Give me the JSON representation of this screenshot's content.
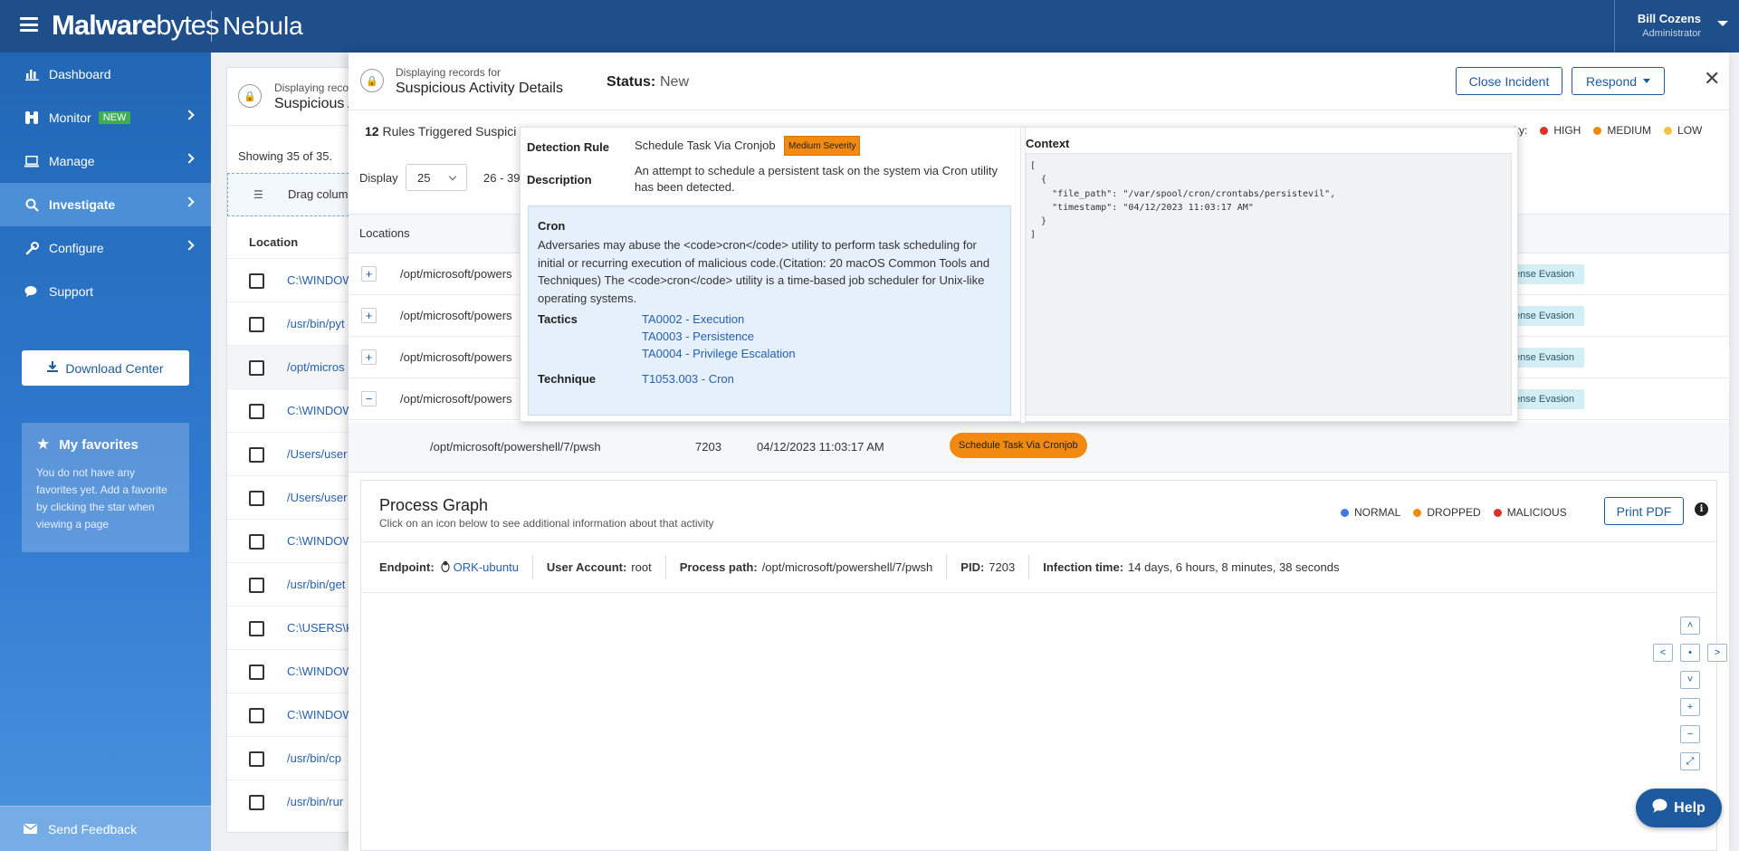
{
  "header": {
    "brand_bold": "Malware",
    "brand_light": "bytes",
    "product": "Nebula",
    "user_name": "Bill Cozens",
    "user_role": "Administrator"
  },
  "sidebar": {
    "items": [
      {
        "label": "Dashboard",
        "icon": "bar-chart-icon"
      },
      {
        "label": "Monitor",
        "badge": "NEW",
        "icon": "binoculars-icon"
      },
      {
        "label": "Manage",
        "icon": "laptop-icon"
      },
      {
        "label": "Investigate",
        "icon": "search-icon",
        "active": true
      },
      {
        "label": "Configure",
        "icon": "wrench-icon"
      },
      {
        "label": "Support",
        "icon": "chat-icon"
      }
    ],
    "download_label": "Download Center",
    "favorites_title": "My favorites",
    "favorites_text": "You do not have any favorites yet. Add a favorite by clicking the star when viewing a page",
    "feedback_label": "Send Feedback"
  },
  "background": {
    "subtitle": "Displaying reco",
    "title": "Suspicious A",
    "showing": "Showing 35 of 35.",
    "drag_text": "Drag colum",
    "column_location": "Location",
    "rows": [
      "C:\\WINDOW",
      "/usr/bin/pyt",
      "/opt/micros",
      "C:\\WINDOW",
      "/Users/user",
      "/Users/user",
      "C:\\WINDOW",
      "/usr/bin/get",
      "C:\\USERS\\K",
      "C:\\WINDOW",
      "C:\\WINDOW",
      "/usr/bin/cp",
      "/usr/bin/rur"
    ]
  },
  "modal": {
    "subtitle": "Displaying records for",
    "title": "Suspicious Activity Details",
    "status_label": "Status:",
    "status_value": "New",
    "close_incident": "Close Incident",
    "respond": "Respond",
    "close_symbol": "✕",
    "rules_count": "12",
    "rules_text": " Rules Triggered Suspici",
    "severity_prefix": "ity:",
    "severity_levels": [
      {
        "label": "HIGH",
        "color": "#d9342b"
      },
      {
        "label": "MEDIUM",
        "color": "#f28a12"
      },
      {
        "label": "LOW",
        "color": "#f5c242"
      }
    ],
    "display_label": "Display",
    "display_value": "25",
    "range_text": "26 - 39",
    "locations_header": "Locations",
    "location_rows": [
      {
        "expander": "+",
        "path": "/opt/microsoft/powers",
        "tag": "ense Evasion"
      },
      {
        "expander": "+",
        "path": "/opt/microsoft/powers",
        "tag": "ense Evasion"
      },
      {
        "expander": "+",
        "path": "/opt/microsoft/powers",
        "tag": "ense Evasion"
      },
      {
        "expander": "−",
        "path": "/opt/microsoft/powers",
        "tag": "ense Evasion"
      }
    ],
    "expanded": {
      "path": "/opt/microsoft/powershell/7/pwsh",
      "pid": "7203",
      "timestamp": "04/12/2023 11:03:17 AM",
      "rule": "Schedule Task Via Cronjob"
    }
  },
  "popover": {
    "detection_rule_label": "Detection Rule",
    "detection_rule_value": "Schedule Task Via Cronjob",
    "severity_tag": "Medium Severity",
    "description_label": "Description",
    "description_value": "An attempt to schedule a persistent task on the system via Cron utility has been detected.",
    "box_title": "Cron",
    "box_text": "Adversaries may abuse the <code>cron</code> utility to perform task scheduling for initial or recurring execution of malicious code.(Citation: 20 macOS Common Tools and Techniques) The <code>cron</code> utility is a time-based job scheduler for Unix-like operating systems.",
    "tactics_label": "Tactics",
    "tactics": [
      "TA0002 - Execution",
      "TA0003 - Persistence",
      "TA0004 - Privilege Escalation"
    ],
    "technique_label": "Technique",
    "technique": "T1053.003 - Cron",
    "context_label": "Context",
    "context_json": "[\n  {\n    \"file_path\": \"/var/spool/cron/crontabs/persistevil\",\n    \"timestamp\": \"04/12/2023 11:03:17 AM\"\n  }\n]"
  },
  "process_graph": {
    "title": "Process Graph",
    "subtitle": "Click on an icon below to see additional information about that activity",
    "legend": [
      {
        "label": "NORMAL",
        "color": "#3b7be0"
      },
      {
        "label": "DROPPED",
        "color": "#f28a12"
      },
      {
        "label": "MALICIOUS",
        "color": "#d9342b"
      }
    ],
    "print_label": "Print PDF",
    "endpoint_label": "Endpoint:",
    "endpoint_value": "ORK-ubuntu",
    "user_label": "User Account:",
    "user_value": "root",
    "path_label": "Process path:",
    "path_value": "/opt/microsoft/powershell/7/pwsh",
    "pid_label": "PID:",
    "pid_value": "7203",
    "infection_label": "Infection time:",
    "infection_value": "14 days, 6 hours, 8 minutes, 38 seconds",
    "controls": {
      "up": "˄",
      "left": "<",
      "center": "•",
      "right": ">",
      "down": "˅",
      "zoom_in": "+",
      "zoom_out": "−",
      "fit": "⤢"
    }
  },
  "help": {
    "label": "Help"
  }
}
